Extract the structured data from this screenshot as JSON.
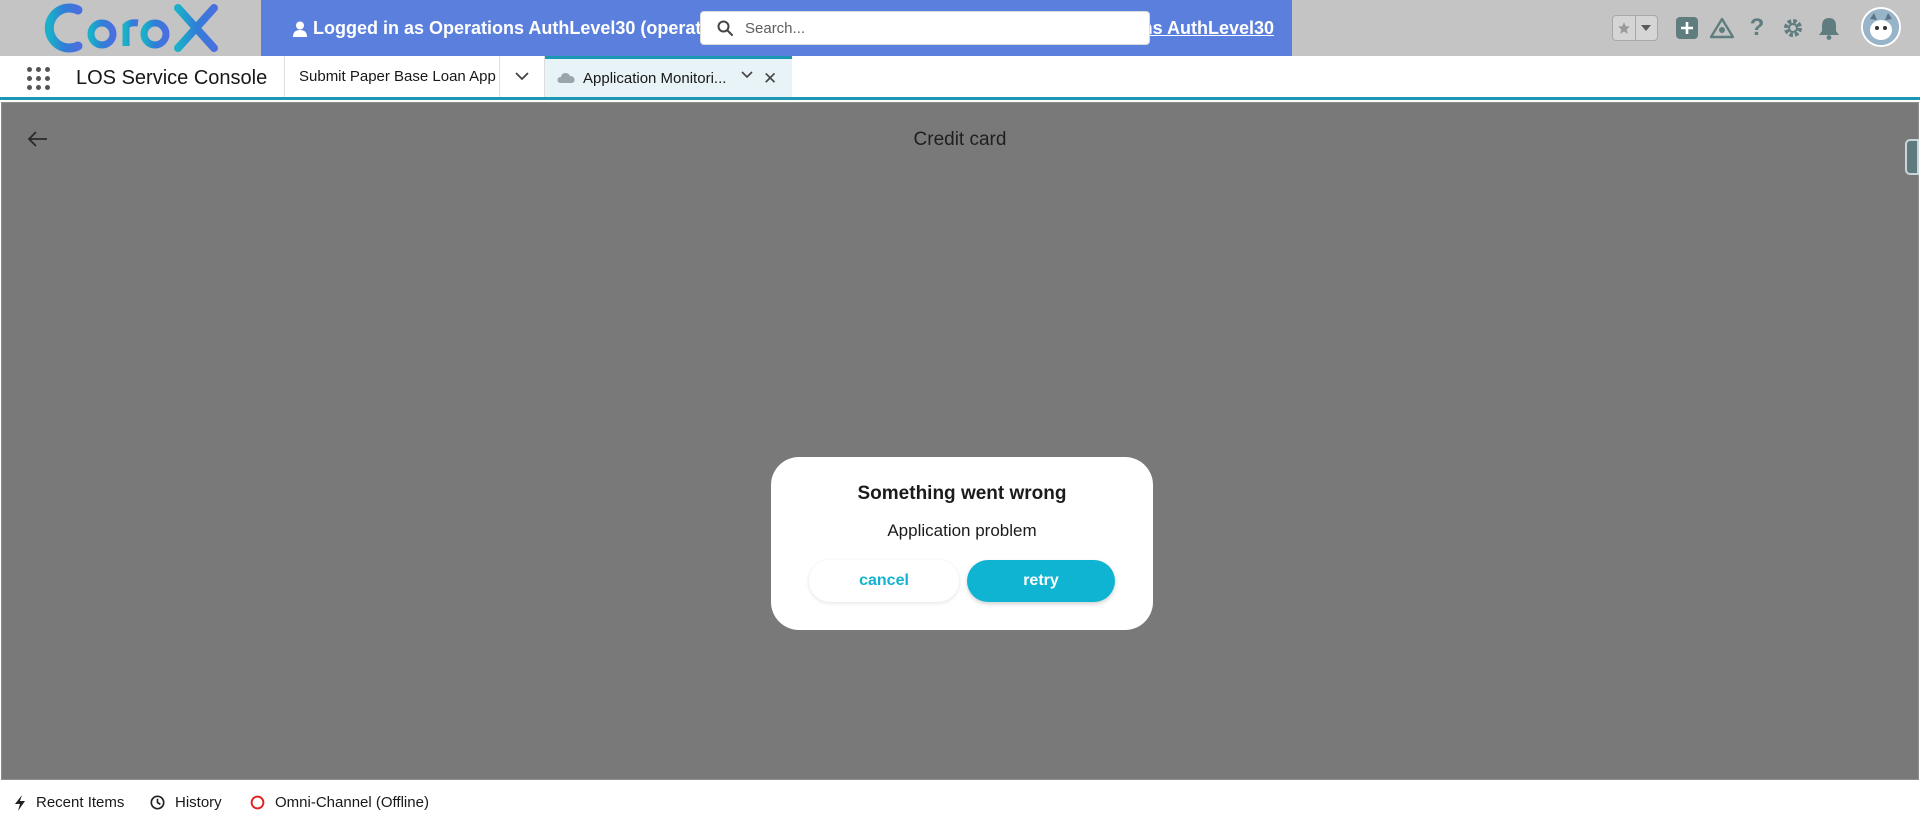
{
  "header": {
    "logo_text": "CardX",
    "login_left": "Logged in as Operations AuthLevel30 (operations",
    "login_right": "ons AuthLevel30",
    "search": {
      "placeholder": "Search..."
    },
    "icons": [
      "favorite-star-icon",
      "favorites-dropdown-icon",
      "global-actions-icon",
      "trailhead-icon",
      "help-icon",
      "setup-gear-icon",
      "notifications-bell-icon",
      "avatar"
    ]
  },
  "nav": {
    "app_name": "LOS Service Console",
    "tabs": [
      {
        "label": "Submit Paper Base Loan App"
      },
      {
        "label": "Application Monitori..."
      }
    ]
  },
  "workspace": {
    "title": "Credit card"
  },
  "dialog": {
    "title": "Something went wrong",
    "message": "Application problem",
    "cancel_label": "cancel",
    "retry_label": "retry"
  },
  "footer": {
    "items": [
      {
        "label": "Recent Items"
      },
      {
        "label": "History"
      },
      {
        "label": "Omni-Channel (Offline)"
      }
    ]
  },
  "colors": {
    "banner": "#5b7fdc",
    "accent": "#0fb4d3",
    "tab_accent": "#1b96b5",
    "overlay": "#797979",
    "offline_status": "#e02020"
  }
}
